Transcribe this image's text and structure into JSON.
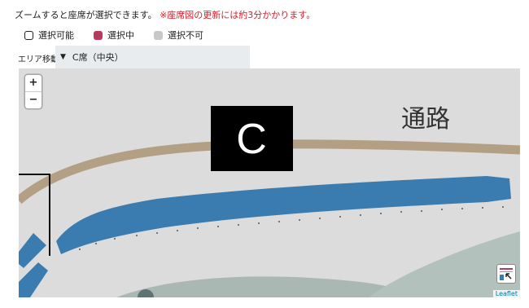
{
  "notice": {
    "text": "ズームすると座席が選択できます。",
    "warning": "※座席図の更新には約3分かかります。"
  },
  "legend": [
    {
      "label": "選択可能",
      "color": "#ffffff"
    },
    {
      "label": "選択中",
      "color": "#b83a5e"
    },
    {
      "label": "選択不可",
      "color": "#c8c8c8"
    }
  ],
  "area": {
    "label": "エリア移動",
    "selected": "C席（中央）"
  },
  "map": {
    "zoom_in": "+",
    "zoom_out": "−",
    "section_label": "C",
    "aisle_label": "通路",
    "attribution": "Leaflet",
    "colors": {
      "seat_block": "#3a7cb0",
      "aisle": "#b39f84",
      "ground": "#dcdcdc",
      "landscape": "#a9b8b3"
    }
  }
}
